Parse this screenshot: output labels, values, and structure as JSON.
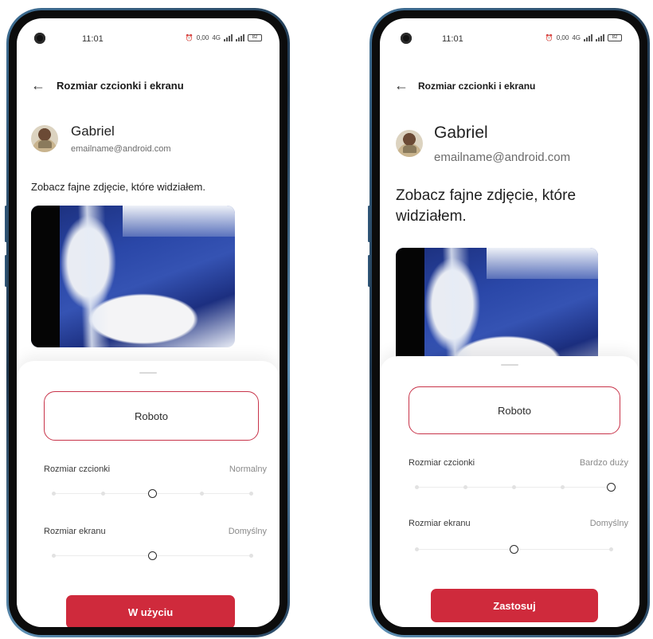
{
  "screens": [
    {
      "status": {
        "time": "11:01",
        "net_speed": "0,00",
        "net_unit": "KB/S",
        "network": "4G",
        "battery": "82"
      },
      "appbar": {
        "title": "Rozmiar czcionki i ekranu"
      },
      "profile": {
        "name": "Gabriel",
        "email": "emailname@android.com"
      },
      "message": "Zobacz fajne zdjęcie, które widziałem.",
      "font_select": {
        "value": "Roboto"
      },
      "font_size": {
        "label": "Rozmiar czcionki",
        "value": "Normalny",
        "steps": 5,
        "selected_step": 3
      },
      "screen_size": {
        "label": "Rozmiar ekranu",
        "value": "Domyślny",
        "steps": 3,
        "selected_step": 2
      },
      "cta_label": "W użyciu"
    },
    {
      "status": {
        "time": "11:01",
        "net_speed": "0,00",
        "net_unit": "KB/S",
        "network": "4G",
        "battery": "82"
      },
      "appbar": {
        "title": "Rozmiar czcionki i ekranu"
      },
      "profile": {
        "name": "Gabriel",
        "email": "emailname@android.com"
      },
      "message": "Zobacz fajne zdjęcie, które widziałem.",
      "font_select": {
        "value": "Roboto"
      },
      "font_size": {
        "label": "Rozmiar czcionki",
        "value": "Bardzo duży",
        "steps": 5,
        "selected_step": 5
      },
      "screen_size": {
        "label": "Rozmiar ekranu",
        "value": "Domyślny",
        "steps": 3,
        "selected_step": 2
      },
      "cta_label": "Zastosuj"
    }
  ],
  "colors": {
    "accent": "#cf2a3c",
    "frame": "#2f5577"
  }
}
